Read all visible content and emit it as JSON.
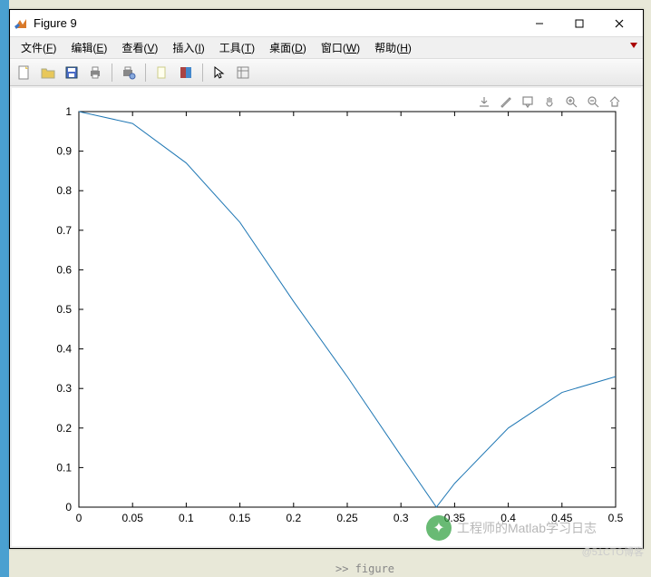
{
  "window": {
    "title": "Figure 9",
    "minimize_label": "minimize",
    "maximize_label": "maximize",
    "close_label": "close"
  },
  "menu": {
    "file": {
      "label": "文件",
      "accel": "F"
    },
    "edit": {
      "label": "编辑",
      "accel": "E"
    },
    "view": {
      "label": "查看",
      "accel": "V"
    },
    "insert": {
      "label": "插入",
      "accel": "I"
    },
    "tools": {
      "label": "工具",
      "accel": "T"
    },
    "desktop": {
      "label": "桌面",
      "accel": "D"
    },
    "windowm": {
      "label": "窗口",
      "accel": "W"
    },
    "help": {
      "label": "帮助",
      "accel": "H"
    }
  },
  "toolbar": {
    "new": "new-file",
    "open": "open-file",
    "save": "save",
    "print": "print",
    "print_preview": "print-preview",
    "link": "link-data",
    "colorbar": "colorbar",
    "pointer": "pointer",
    "plottools": "plot-tools"
  },
  "axes_toolbar": {
    "export": "export",
    "brush": "brush",
    "datatips": "data-tips",
    "pan": "pan",
    "zoom_in": "zoom-in",
    "zoom_out": "zoom-out",
    "home": "restore-view"
  },
  "chart_data": {
    "type": "line",
    "x": [
      0,
      0.05,
      0.1,
      0.15,
      0.2,
      0.25,
      0.3,
      0.333,
      0.35,
      0.4,
      0.45,
      0.5
    ],
    "values": [
      1.0,
      0.97,
      0.87,
      0.72,
      0.52,
      0.33,
      0.13,
      0.0,
      0.06,
      0.2,
      0.29,
      0.33
    ],
    "xlabel": "",
    "ylabel": "",
    "xlim": [
      0,
      0.5
    ],
    "ylim": [
      0,
      1
    ],
    "xticks": [
      0,
      0.05,
      0.1,
      0.15,
      0.2,
      0.25,
      0.3,
      0.35,
      0.4,
      0.45,
      0.5
    ],
    "yticks": [
      0,
      0.1,
      0.2,
      0.3,
      0.4,
      0.5,
      0.6,
      0.7,
      0.8,
      0.9,
      1
    ]
  },
  "watermark": {
    "text": "工程师的Matlab学习日志",
    "sub": "@51CTO博客"
  },
  "cmd_echo": ">> figure"
}
